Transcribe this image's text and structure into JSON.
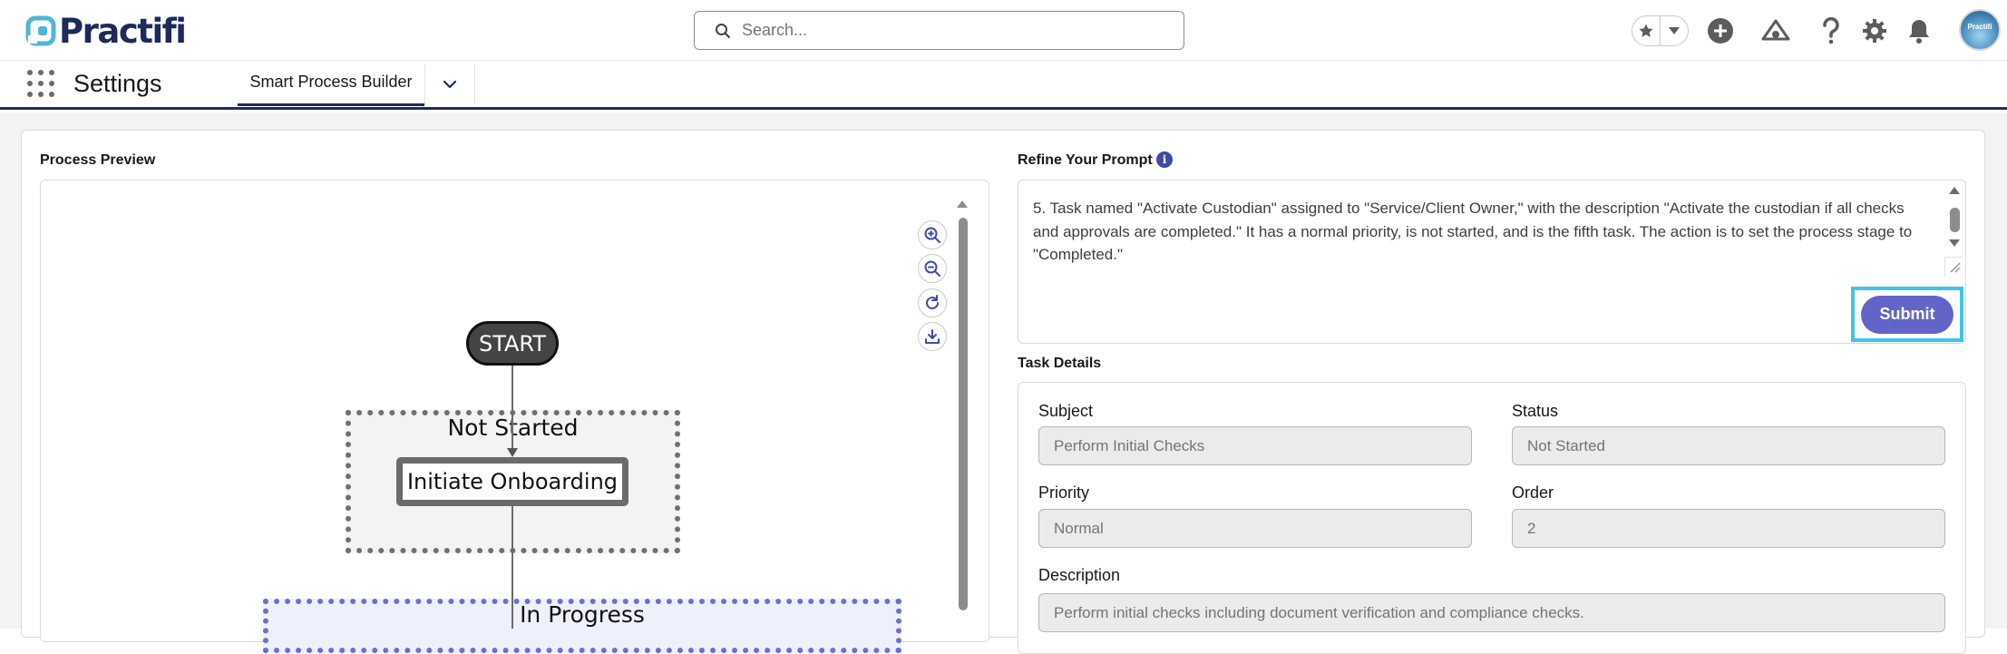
{
  "header": {
    "brand": "Practifi",
    "search": {
      "placeholder": "Search...",
      "value": ""
    },
    "icons": [
      "favorites-star-icon",
      "favorites-dropdown-icon",
      "add-icon",
      "trailhead-icon",
      "help-icon",
      "setup-gear-icon",
      "notifications-bell-icon"
    ],
    "avatar_text": "Practifi"
  },
  "nav": {
    "app_name": "Settings",
    "tabs": [
      {
        "label": "Smart Process Builder",
        "active": true
      }
    ],
    "more_icon": "chevron-down-icon"
  },
  "preview": {
    "title": "Process Preview",
    "zoom_controls": [
      "zoom-in-icon",
      "zoom-out-icon",
      "refresh-icon",
      "download-icon"
    ],
    "diagram": {
      "start_label": "START",
      "stages": [
        {
          "label": "Not Started",
          "tasks": [
            "Initiate Onboarding"
          ],
          "color": "#707070"
        },
        {
          "label": "In Progress",
          "tasks": [],
          "color": "#6e6ed2"
        }
      ]
    }
  },
  "prompt": {
    "title": "Refine Your Prompt",
    "info_icon": "info-icon",
    "text": "5. Task named \"Activate Custodian\" assigned to \"Service/Client Owner,\" with the description \"Activate the custodian if all checks and approvals are completed.\" It has a normal priority, is not started, and is the fifth task. The action is to set the process stage to \"Completed.\"",
    "submit_label": "Submit"
  },
  "task_details": {
    "title": "Task Details",
    "subject_label": "Subject",
    "subject_value": "Perform Initial Checks",
    "status_label": "Status",
    "status_value": "Not Started",
    "priority_label": "Priority",
    "priority_value": "Normal",
    "order_label": "Order",
    "order_value": "2",
    "description_label": "Description",
    "description_value": "Perform initial checks including document verification and compliance checks."
  },
  "colors": {
    "brand_navy": "#1d2a5c",
    "brand_teal": "#4fb7d4",
    "submit_button": "#6264c8",
    "highlight": "#3ec4ef"
  }
}
